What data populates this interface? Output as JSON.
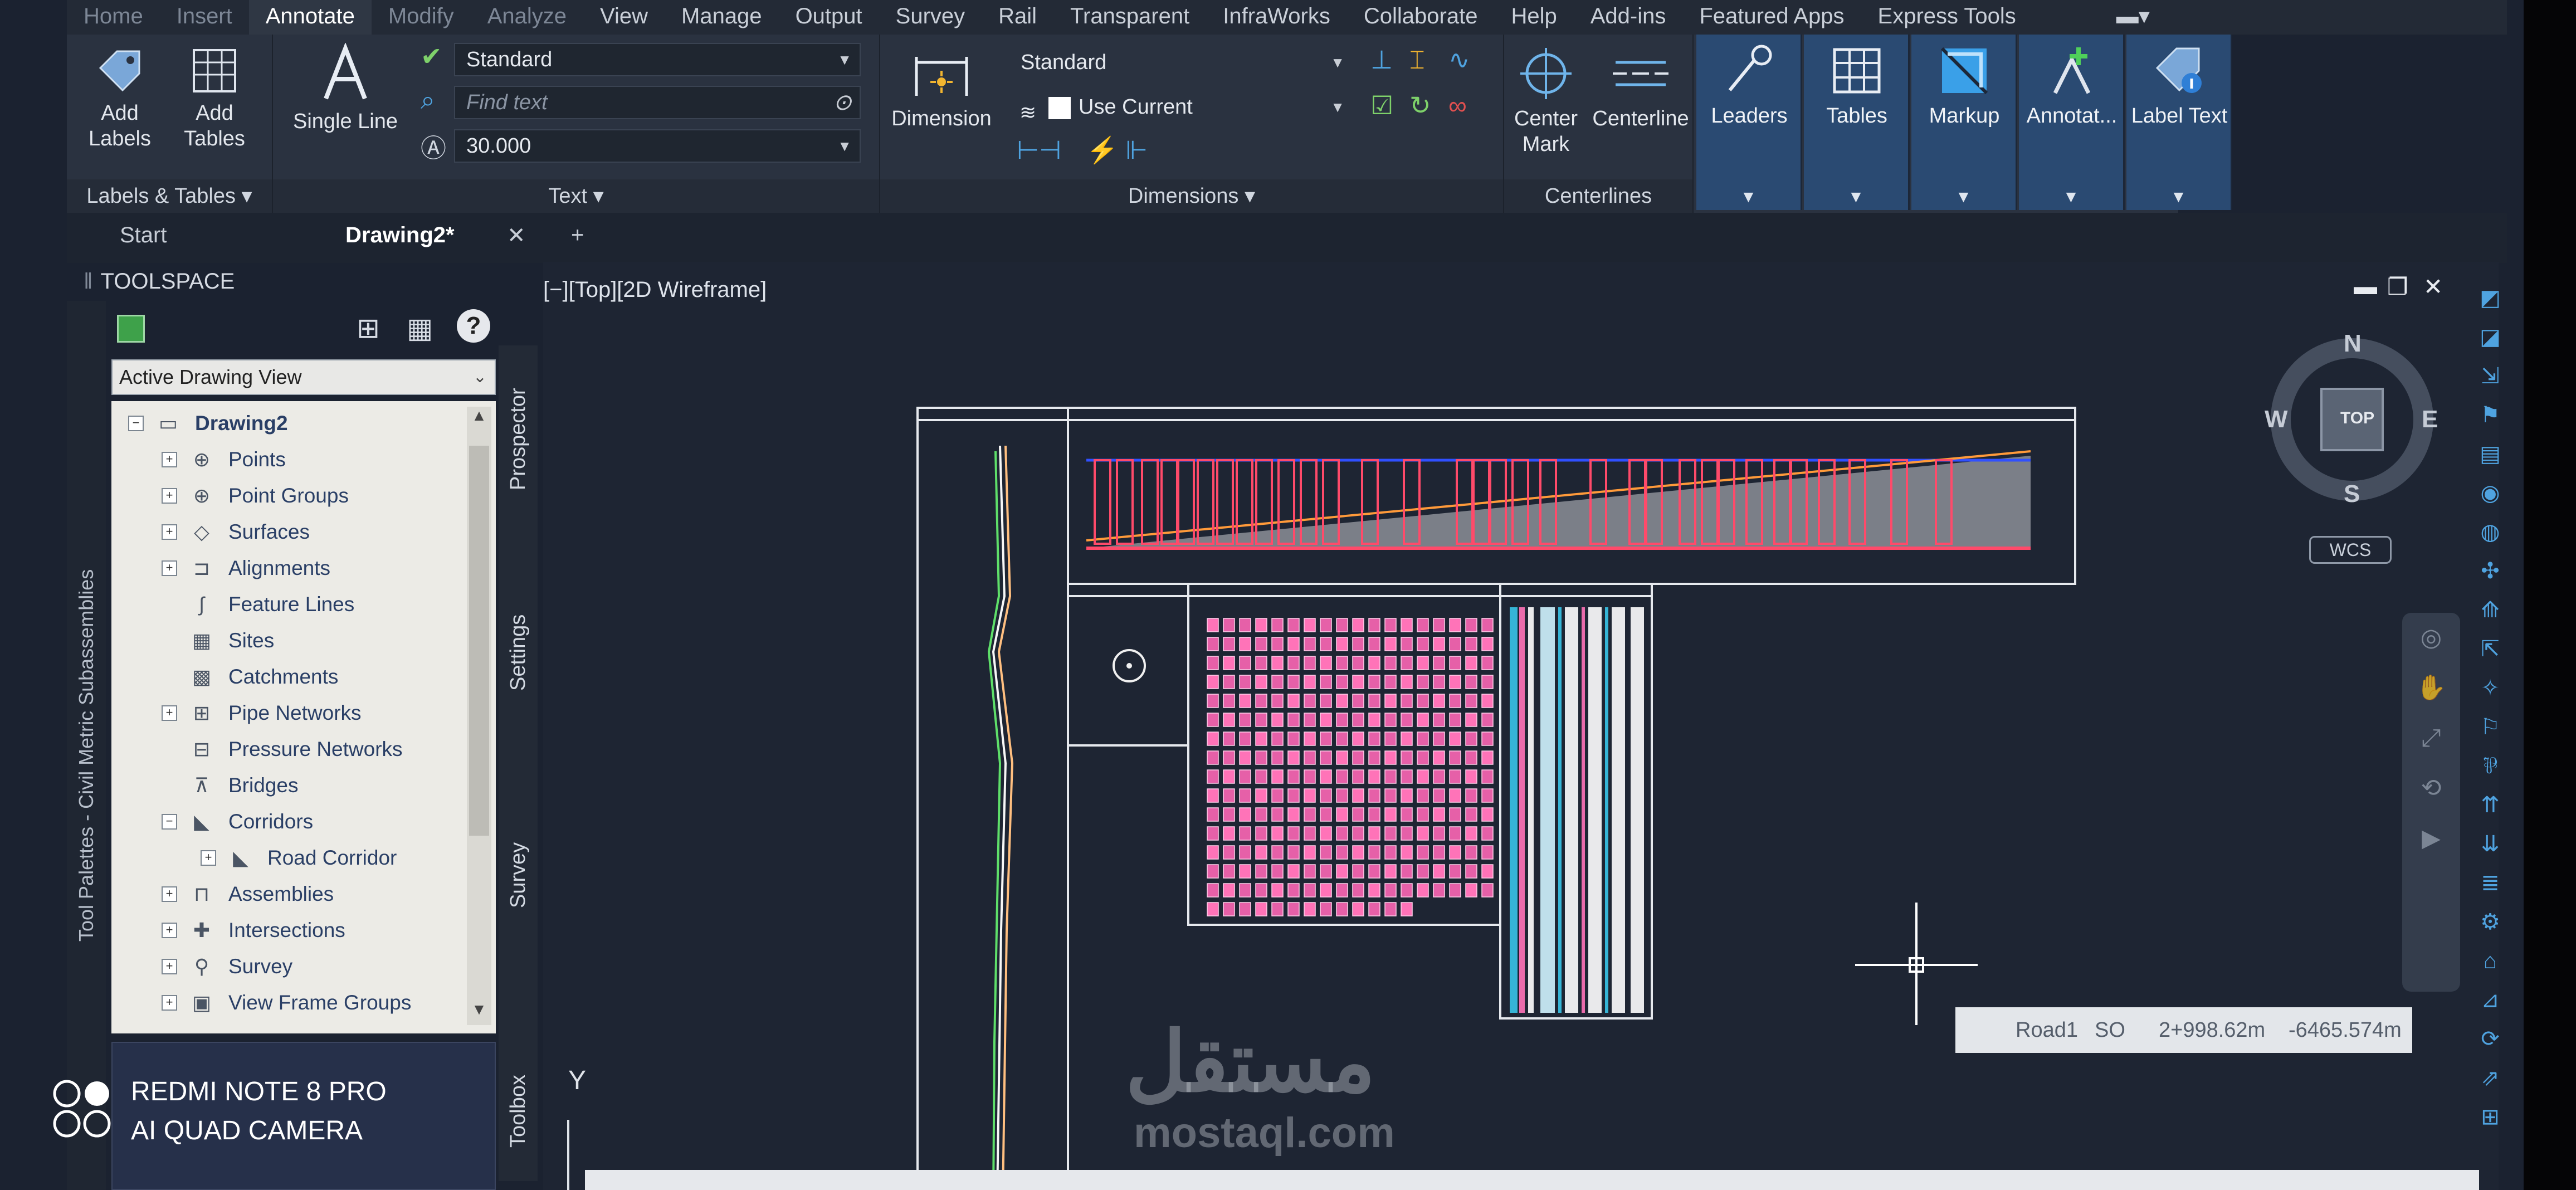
{
  "menu": {
    "items": [
      "Home",
      "Insert",
      "Annotate",
      "Modify",
      "Analyze",
      "View",
      "Manage",
      "Output",
      "Survey",
      "Rail",
      "Transparent",
      "InfraWorks",
      "Collaborate",
      "Help",
      "Add-ins",
      "Featured Apps",
      "Express Tools"
    ],
    "active": "Annotate"
  },
  "ribbon": {
    "labels_tables": {
      "title": "Labels & Tables",
      "add_labels": "Add\nLabels",
      "add_tables": "Add\nTables"
    },
    "text": {
      "title": "Text",
      "single_line": "Single Line",
      "style": "Standard",
      "find_placeholder": "Find text",
      "height": "30.000"
    },
    "dimensions": {
      "title": "Dimensions",
      "dimension": "Dimension",
      "style": "Standard",
      "layer": "Use Current"
    },
    "centerlines": {
      "title": "Centerlines",
      "center_mark": "Center\nMark",
      "centerline": "Centerline"
    },
    "blue_tools": {
      "leaders": "Leaders",
      "tables": "Tables",
      "markup": "Markup",
      "annotate": "Annotat...",
      "label_text": "Label Text"
    }
  },
  "tabs": {
    "start": "Start",
    "drawing": "Drawing2*",
    "close": "✕",
    "add": "+"
  },
  "toolspace": {
    "title": "TOOLSPACE",
    "view_dropdown": "Active Drawing View",
    "palette_label": "Tool Palettes - Civil Metric Subassemblies",
    "side_tabs": [
      "Prospector",
      "Settings",
      "Survey",
      "Toolbox"
    ],
    "tree": [
      {
        "label": "Drawing2",
        "level": 0,
        "expand": "−",
        "icon": "▭",
        "bold": true
      },
      {
        "label": "Points",
        "level": 1,
        "expand": "+",
        "icon": "⊕"
      },
      {
        "label": "Point Groups",
        "level": 1,
        "expand": "+",
        "icon": "⊕"
      },
      {
        "label": "Surfaces",
        "level": 1,
        "expand": "+",
        "icon": "◇"
      },
      {
        "label": "Alignments",
        "level": 1,
        "expand": "+",
        "icon": "⊐"
      },
      {
        "label": "Feature Lines",
        "level": 1,
        "expand": "",
        "icon": "∫"
      },
      {
        "label": "Sites",
        "level": 1,
        "expand": "",
        "icon": "▦"
      },
      {
        "label": "Catchments",
        "level": 1,
        "expand": "",
        "icon": "▩"
      },
      {
        "label": "Pipe Networks",
        "level": 1,
        "expand": "+",
        "icon": "⊞"
      },
      {
        "label": "Pressure Networks",
        "level": 1,
        "expand": "",
        "icon": "⊟"
      },
      {
        "label": "Bridges",
        "level": 1,
        "expand": "",
        "icon": "⊼"
      },
      {
        "label": "Corridors",
        "level": 1,
        "expand": "−",
        "icon": "◣"
      },
      {
        "label": "Road Corridor",
        "level": 2,
        "expand": "+",
        "icon": "◣"
      },
      {
        "label": "Assemblies",
        "level": 1,
        "expand": "+",
        "icon": "⊓"
      },
      {
        "label": "Intersections",
        "level": 1,
        "expand": "+",
        "icon": "✚"
      },
      {
        "label": "Survey",
        "level": 1,
        "expand": "+",
        "icon": "⚲"
      },
      {
        "label": "View Frame Groups",
        "level": 1,
        "expand": "+",
        "icon": "▣"
      }
    ]
  },
  "viewport": {
    "label": "[−][Top][2D Wireframe]",
    "compass": {
      "n": "N",
      "s": "S",
      "e": "E",
      "w": "W",
      "top": "TOP",
      "wcs": "WCS"
    },
    "status": {
      "alignment": "Road1",
      "offset_side": "SO",
      "station": "2+998.62m",
      "offset": "-6465.574m"
    },
    "y_axis": "Y"
  },
  "watermark": {
    "arabic": "مستقل",
    "latin": "mostaql.com"
  },
  "camera": {
    "line1": "REDMI NOTE 8 PRO",
    "line2": "AI QUAD CAMERA"
  },
  "colors": {
    "ribbon_bg": "#2a3240",
    "blue_panel": "#2a4a72",
    "accent": "#4fa3e0",
    "viewport_bg": "#1e2533"
  }
}
